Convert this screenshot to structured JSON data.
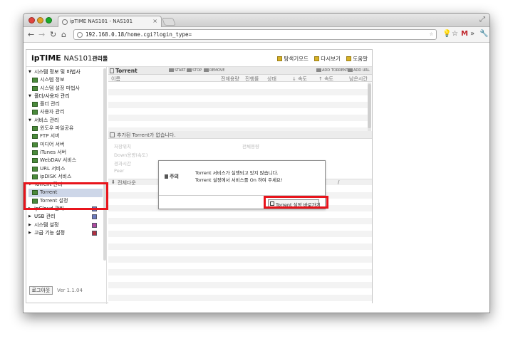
{
  "browser": {
    "tab_title": "ipTIME NAS101 - NAS101",
    "url": "192.168.0.18/home.cgi?login_type="
  },
  "brand": {
    "logo": "ipTIME",
    "model": "NAS101",
    "suffix": "관리툴"
  },
  "top_links": [
    {
      "label": "탐색기모드"
    },
    {
      "label": "다시보기"
    },
    {
      "label": "도움말"
    }
  ],
  "sidebar": {
    "items": [
      {
        "label": "시스템 정보 및 마법사",
        "type": "cat"
      },
      {
        "label": "시스템 정보",
        "type": "sub"
      },
      {
        "label": "시스템 설정 마법사",
        "type": "sub"
      },
      {
        "label": "폴더/사용자 관리",
        "type": "cat"
      },
      {
        "label": "폴더 관리",
        "type": "sub"
      },
      {
        "label": "사용자 관리",
        "type": "sub"
      },
      {
        "label": "서비스 관리",
        "type": "cat"
      },
      {
        "label": "윈도우 파일공유",
        "type": "sub"
      },
      {
        "label": "FTP 서버",
        "type": "sub"
      },
      {
        "label": "미디어 서버",
        "type": "sub"
      },
      {
        "label": "iTunes 서버",
        "type": "sub"
      },
      {
        "label": "WebDAV 서비스",
        "type": "sub"
      },
      {
        "label": "URL 서비스",
        "type": "sub"
      },
      {
        "label": "ipDISK 서비스",
        "type": "sub"
      },
      {
        "label": "Torrent 관리",
        "type": "cat"
      },
      {
        "label": "Torrent",
        "type": "sub",
        "active": true
      },
      {
        "label": "Torrent 설정",
        "type": "sub"
      },
      {
        "label": "ipCloud 관리",
        "type": "cat-closed"
      },
      {
        "label": "USB 관리",
        "type": "cat-closed"
      },
      {
        "label": "시스템 설정",
        "type": "cat-closed"
      },
      {
        "label": "고급 기능 설정",
        "type": "cat-closed"
      }
    ],
    "logout_label": "로그아웃",
    "version": "Ver 1.1.04"
  },
  "main": {
    "title": "Torrent",
    "actions": {
      "start": "START",
      "stop": "STOP",
      "remove": "REMOVE",
      "add_torrent": "ADD TORRENT",
      "add_url": "ADD URL"
    },
    "columns": {
      "name": "이름",
      "total": "전체용량",
      "progress": "진행률",
      "status": "상태",
      "down_speed": "↓ 속도",
      "up_speed": "↑ 속도",
      "remaining": "남은시간"
    },
    "empty_message": "추가된 Torrent가 없습니다.",
    "details": {
      "save_location": "저장위치",
      "downloaded": "Down용량(속도)",
      "elapsed": "경과시간",
      "peer": "Peer",
      "total_size": "전체용량",
      "all_downloads": "전체다운",
      "slash": "/"
    }
  },
  "dialog": {
    "title": "주의",
    "line1": "Torrent 서비스가 실행되고 있지 않습니다.",
    "line2": "Torrent 설정에서 서비스를 On 하여 주세요!",
    "button": "Torrent 설정 바로가기"
  },
  "colors": {
    "highlight": "#e8141c",
    "active_menu_bg": "#cdd6e8"
  }
}
